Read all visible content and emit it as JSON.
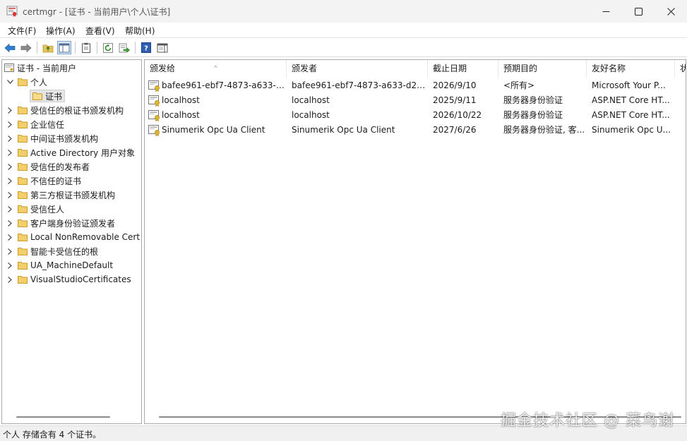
{
  "window": {
    "title": "certmgr - [证书 - 当前用户\\个人\\证书]"
  },
  "menu": {
    "file": "文件(F)",
    "action": "操作(A)",
    "view": "查看(V)",
    "help": "帮助(H)"
  },
  "tree": {
    "root": "证书 - 当前用户",
    "personal": "个人",
    "certs": "证书",
    "items": [
      "受信任的根证书颁发机构",
      "企业信任",
      "中间证书颁发机构",
      "Active Directory 用户对象",
      "受信任的发布者",
      "不信任的证书",
      "第三方根证书颁发机构",
      "受信任人",
      "客户端身份验证颁发者",
      "Local NonRemovable Cert",
      "智能卡受信任的根",
      "UA_MachineDefault",
      "VisualStudioCertificates"
    ]
  },
  "columns": {
    "issued_to": "颁发给",
    "issued_by": "颁发者",
    "expiry": "截止日期",
    "purpose": "预期目的",
    "friendly": "友好名称",
    "status": "状"
  },
  "rows": [
    {
      "issued_to": "bafee961-ebf7-4873-a633-d...",
      "issued_by": "bafee961-ebf7-4873-a633-d2f...",
      "expiry": "2026/9/10",
      "purpose": "<所有>",
      "friendly": "Microsoft Your P..."
    },
    {
      "issued_to": "localhost",
      "issued_by": "localhost",
      "expiry": "2025/9/11",
      "purpose": "服务器身份验证",
      "friendly": "ASP.NET Core HT..."
    },
    {
      "issued_to": "localhost",
      "issued_by": "localhost",
      "expiry": "2026/10/22",
      "purpose": "服务器身份验证",
      "friendly": "ASP.NET Core HT..."
    },
    {
      "issued_to": "Sinumerik Opc Ua Client",
      "issued_by": "Sinumerik Opc Ua Client",
      "expiry": "2027/6/26",
      "purpose": "服务器身份验证, 客...",
      "friendly": "Sinumerik Opc U..."
    }
  ],
  "status": {
    "text": "个人 存储含有 4 个证书。"
  },
  "watermark": "掘金技术社区 @ 菜鸟谢"
}
